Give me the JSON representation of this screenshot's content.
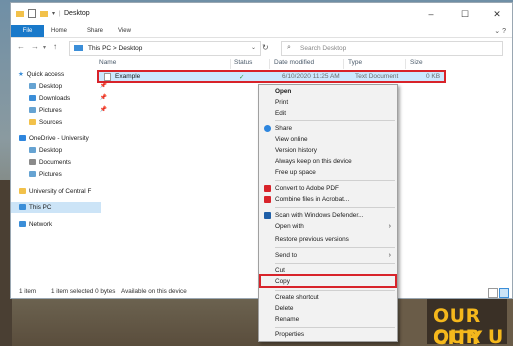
{
  "window": {
    "title": "Desktop"
  },
  "ribbon": {
    "tabs": [
      "File",
      "Home",
      "Share",
      "View"
    ]
  },
  "address": {
    "path": "This PC  >  Desktop",
    "search_placeholder": "Search Desktop"
  },
  "columns": {
    "name": "Name",
    "status": "Status",
    "modified": "Date modified",
    "type": "Type",
    "size": "Size"
  },
  "file": {
    "name": "Example",
    "modified": "6/10/2020 11:25 AM",
    "type": "Text Document",
    "size": "0 KB"
  },
  "sidebar": {
    "quick_access": "Quick access",
    "items": [
      "Desktop",
      "Downloads",
      "Pictures",
      "Sources"
    ],
    "onedrive": "OneDrive - University",
    "onedrive_items": [
      "Desktop",
      "Documents",
      "Pictures"
    ],
    "ucf": "University of Central F",
    "this_pc": "This PC",
    "network": "Network"
  },
  "statusbar": {
    "count": "1 item",
    "selected": "1 item selected  0 bytes",
    "available": "Available on this device"
  },
  "context_menu": {
    "open": "Open",
    "print": "Print",
    "edit": "Edit",
    "share": "Share",
    "view_online": "View online",
    "version_history": "Version history",
    "always_keep": "Always keep on this device",
    "free_up": "Free up space",
    "convert_pdf": "Convert to Adobe PDF",
    "combine_acrobat": "Combine files in Acrobat...",
    "scan_defender": "Scan with Windows Defender...",
    "open_with": "Open with",
    "restore": "Restore previous versions",
    "send_to": "Send to",
    "cut": "Cut",
    "copy": "Copy",
    "create_shortcut": "Create shortcut",
    "delete": "Delete",
    "rename": "Rename",
    "properties": "Properties"
  },
  "desktop": {
    "sign_line1": "OUR CITY",
    "sign_line2": "OUR U"
  },
  "colors": {
    "accent": "#1979ca",
    "highlight": "#d8232a",
    "selection": "#cce8ff"
  }
}
